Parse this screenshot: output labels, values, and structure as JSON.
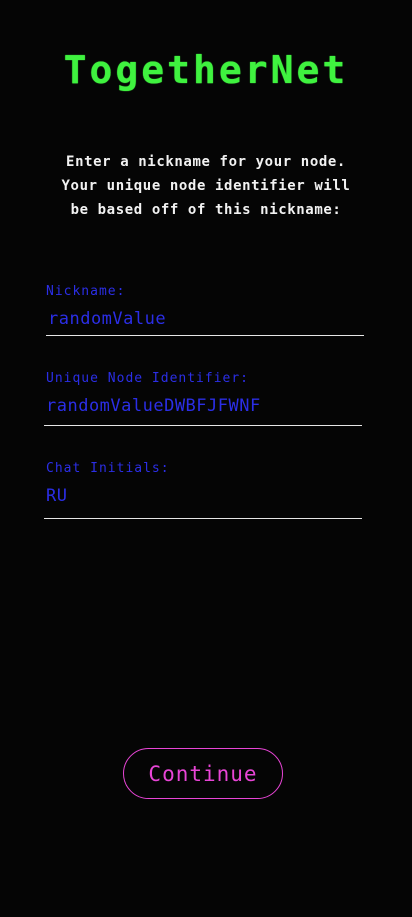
{
  "app": {
    "title": "TogetherNet"
  },
  "instructions": {
    "lines": [
      "Enter a nickname for your node.",
      "Your unique node identifier will",
      "be based off of this nickname:"
    ]
  },
  "form": {
    "nickname": {
      "label": "Nickname:",
      "value": "randomValue"
    },
    "node_identifier": {
      "label": "Unique Node Identifier:",
      "value": "randomValueDWBFJFWNF"
    },
    "chat_initials": {
      "label": "Chat Initials:",
      "value": "RU"
    }
  },
  "actions": {
    "continue_label": "Continue"
  },
  "colors": {
    "background": "#050505",
    "title": "#3ff23f",
    "instructions": "#f2f2f2",
    "field_text": "#2b2ee6",
    "underline": "#e6e6e6",
    "button": "#e845d6"
  }
}
